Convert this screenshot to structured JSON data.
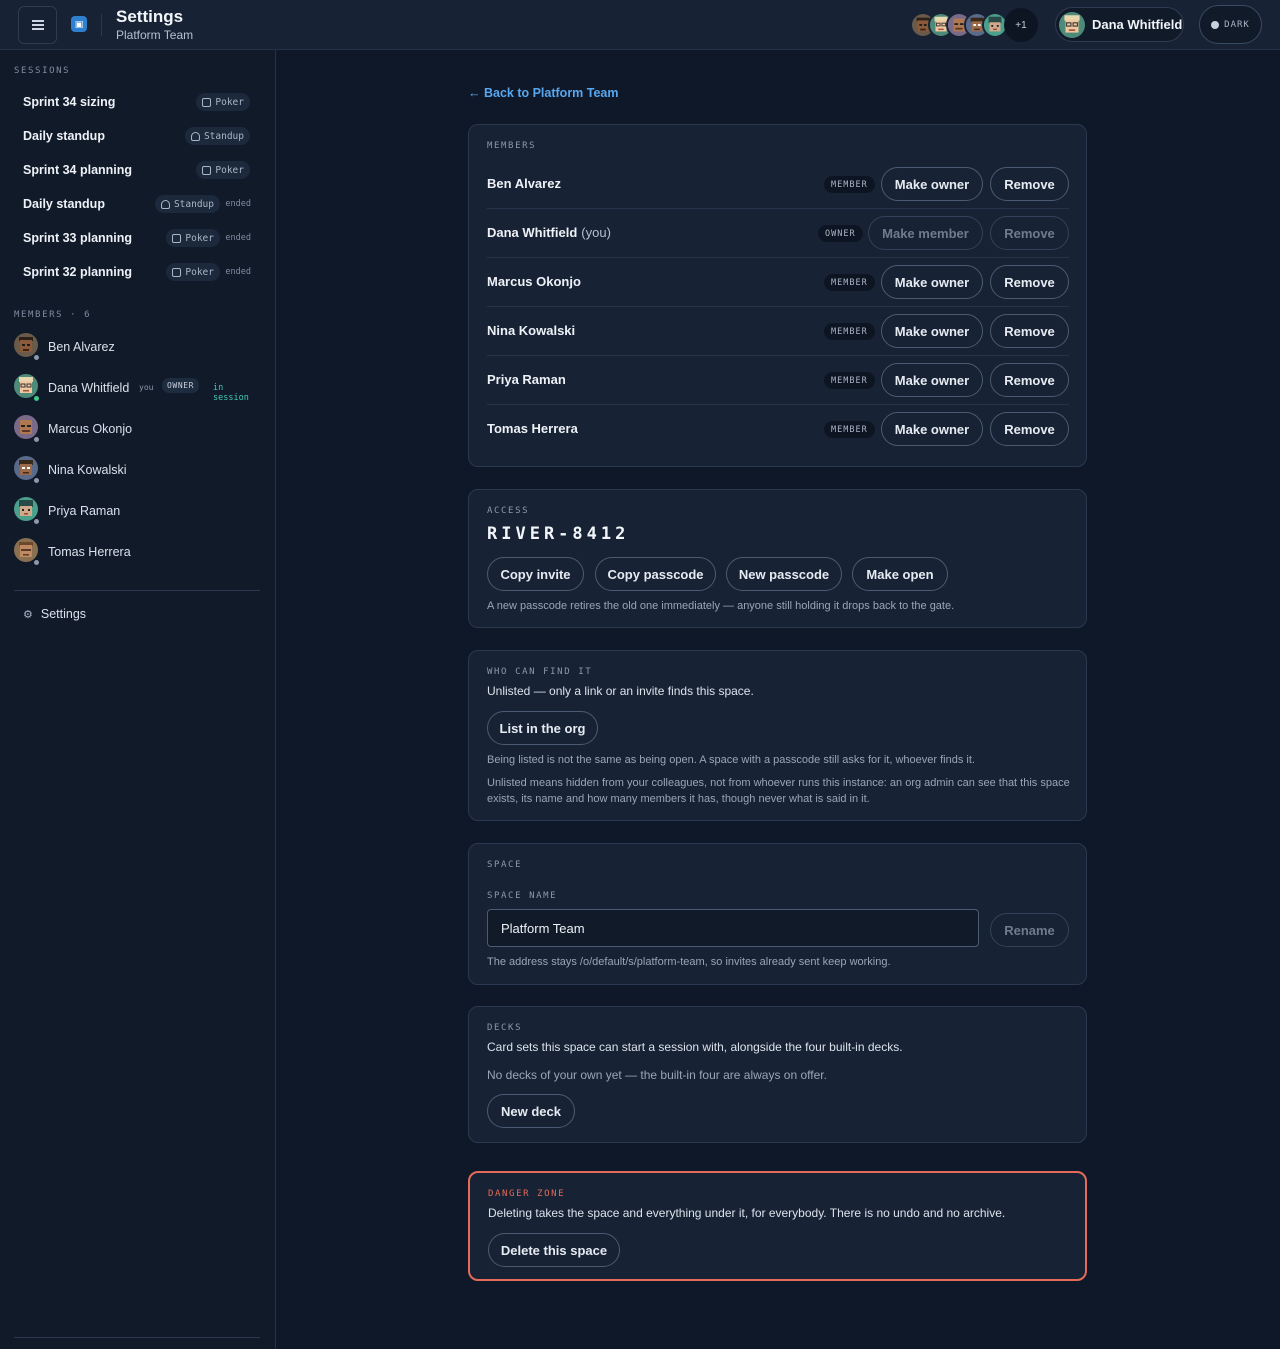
{
  "topbar": {
    "title": "Settings",
    "subtitle": "Platform Team",
    "avatar_overflow": "+1",
    "current_user": "Dana Whitfield",
    "theme_label": "DARK"
  },
  "sidebar": {
    "sessions_label": "SESSIONS",
    "sessions": [
      {
        "title": "Sprint 34 sizing",
        "deck": "Poker",
        "status": ""
      },
      {
        "title": "Daily standup",
        "deck": "Standup",
        "status": ""
      },
      {
        "title": "Sprint 34 planning",
        "deck": "Poker",
        "status": ""
      },
      {
        "title": "Daily standup",
        "deck": "Standup",
        "status": "ended"
      },
      {
        "title": "Sprint 33 planning",
        "deck": "Poker",
        "status": "ended"
      },
      {
        "title": "Sprint 32 planning",
        "deck": "Poker",
        "status": "ended"
      }
    ],
    "members_label": "MEMBERS · 6",
    "members": [
      {
        "name": "Ben Alvarez"
      },
      {
        "name": "Dana Whitfield",
        "you": "you",
        "role": "OWNER",
        "presence": "in session"
      },
      {
        "name": "Marcus Okonjo"
      },
      {
        "name": "Nina Kowalski"
      },
      {
        "name": "Priya Raman"
      },
      {
        "name": "Tomas Herrera"
      }
    ],
    "settings_label": "Settings"
  },
  "main": {
    "back_link": "← Back to Platform Team",
    "members_card": {
      "label": "MEMBERS",
      "rows": [
        {
          "name": "Ben Alvarez",
          "paren": "",
          "role": "MEMBER",
          "promote": "Make owner",
          "remove": "Remove"
        },
        {
          "name": "Dana Whitfield",
          "paren": "(you)",
          "role": "OWNER",
          "promote": "Make member",
          "remove": "Remove"
        },
        {
          "name": "Marcus Okonjo",
          "paren": "",
          "role": "MEMBER",
          "promote": "Make owner",
          "remove": "Remove"
        },
        {
          "name": "Nina Kowalski",
          "paren": "",
          "role": "MEMBER",
          "promote": "Make owner",
          "remove": "Remove"
        },
        {
          "name": "Priya Raman",
          "paren": "",
          "role": "MEMBER",
          "promote": "Make owner",
          "remove": "Remove"
        },
        {
          "name": "Tomas Herrera",
          "paren": "",
          "role": "MEMBER",
          "promote": "Make owner",
          "remove": "Remove"
        }
      ]
    },
    "access_card": {
      "label": "ACCESS",
      "passcode": "RIVER-8412",
      "copy_invite": "Copy invite",
      "copy_passcode": "Copy passcode",
      "new_passcode": "New passcode",
      "make_open": "Make open",
      "note": "A new passcode retires the old one immediately — anyone still holding it drops back to the gate."
    },
    "visibility_card": {
      "label": "WHO CAN FIND IT",
      "status": "Unlisted — only a link or an invite finds this space.",
      "button": "List in the org",
      "note1": "Being listed is not the same as being open. A space with a passcode still asks for it, whoever finds it.",
      "note2": "Unlisted means hidden from your colleagues, not from whoever runs this instance: an org admin can see that this space exists, its name and how many members it has, though never what is said in it."
    },
    "space_card": {
      "label": "SPACE",
      "field_label": "SPACE NAME",
      "name_value": "Platform Team",
      "rename": "Rename",
      "note": "The address stays /o/default/s/platform-team, so invites already sent keep working."
    },
    "decks_card": {
      "label": "DECKS",
      "description": "Card sets this space can start a session with, alongside the four built-in decks.",
      "empty": "No decks of your own yet — the built-in four are always on offer.",
      "button": "New deck"
    },
    "danger_card": {
      "label": "DANGER ZONE",
      "description": "Deleting takes the space and everything under it, for everybody. There is no undo and no archive.",
      "button": "Delete this space"
    }
  },
  "colors": {
    "background": "#0f1828",
    "accent_link": "#56a7f0",
    "danger": "#e46b5a",
    "online": "#3fc98a"
  }
}
